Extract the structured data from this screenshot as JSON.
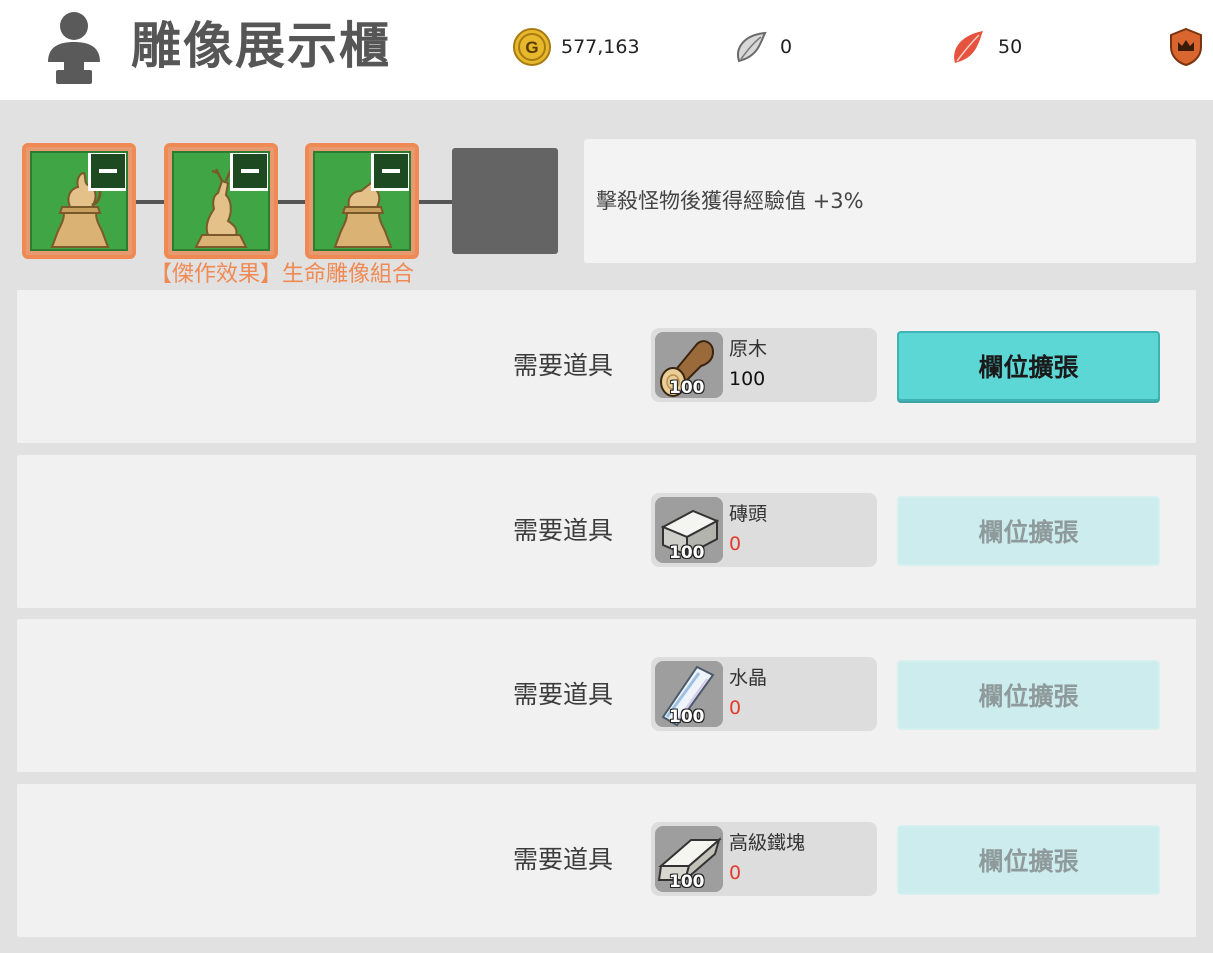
{
  "header": {
    "title": "雕像展示櫃",
    "currencies": [
      {
        "name": "gold",
        "icon": "gold-coin-icon",
        "value": "577,163",
        "color": "#e8b82c"
      },
      {
        "name": "silver-feather",
        "icon": "silver-feather-icon",
        "value": "0",
        "color": "#c8c8c8"
      },
      {
        "name": "red-feather",
        "icon": "red-feather-icon",
        "value": "50",
        "color": "#e5533e"
      },
      {
        "name": "crown-badge",
        "icon": "crown-shield-icon",
        "color": "#d9662f"
      }
    ]
  },
  "slots": [
    {
      "statue": "squirrel-statue-icon",
      "filled": true
    },
    {
      "statue": "deer-statue-icon",
      "filled": true
    },
    {
      "statue": "goat-statue-icon",
      "filled": true
    },
    {
      "statue": null,
      "filled": false
    }
  ],
  "set_label": "【傑作效果】生命雕像組合",
  "effect": "擊殺怪物後獲得經驗值 +3%",
  "rows": [
    {
      "label": "需要道具",
      "item_name": "原木",
      "item_icon": "log-icon",
      "count": "100",
      "have": "100",
      "sufficient": true,
      "button": "欄位擴張",
      "enabled": true
    },
    {
      "label": "需要道具",
      "item_name": "磚頭",
      "item_icon": "brick-icon",
      "count": "100",
      "have": "0",
      "sufficient": false,
      "button": "欄位擴張",
      "enabled": false
    },
    {
      "label": "需要道具",
      "item_name": "水晶",
      "item_icon": "crystal-icon",
      "count": "100",
      "have": "0",
      "sufficient": false,
      "button": "欄位擴張",
      "enabled": false
    },
    {
      "label": "需要道具",
      "item_name": "高級鐵塊",
      "item_icon": "iron-ingot-icon",
      "count": "100",
      "have": "0",
      "sufficient": false,
      "button": "欄位擴張",
      "enabled": false
    }
  ],
  "colors": {
    "accent": "#f08a55",
    "slot_green": "#3fa545",
    "button_active": "#5dd6d6",
    "button_disabled": "#cdeced",
    "insufficient": "#e23b2b"
  }
}
